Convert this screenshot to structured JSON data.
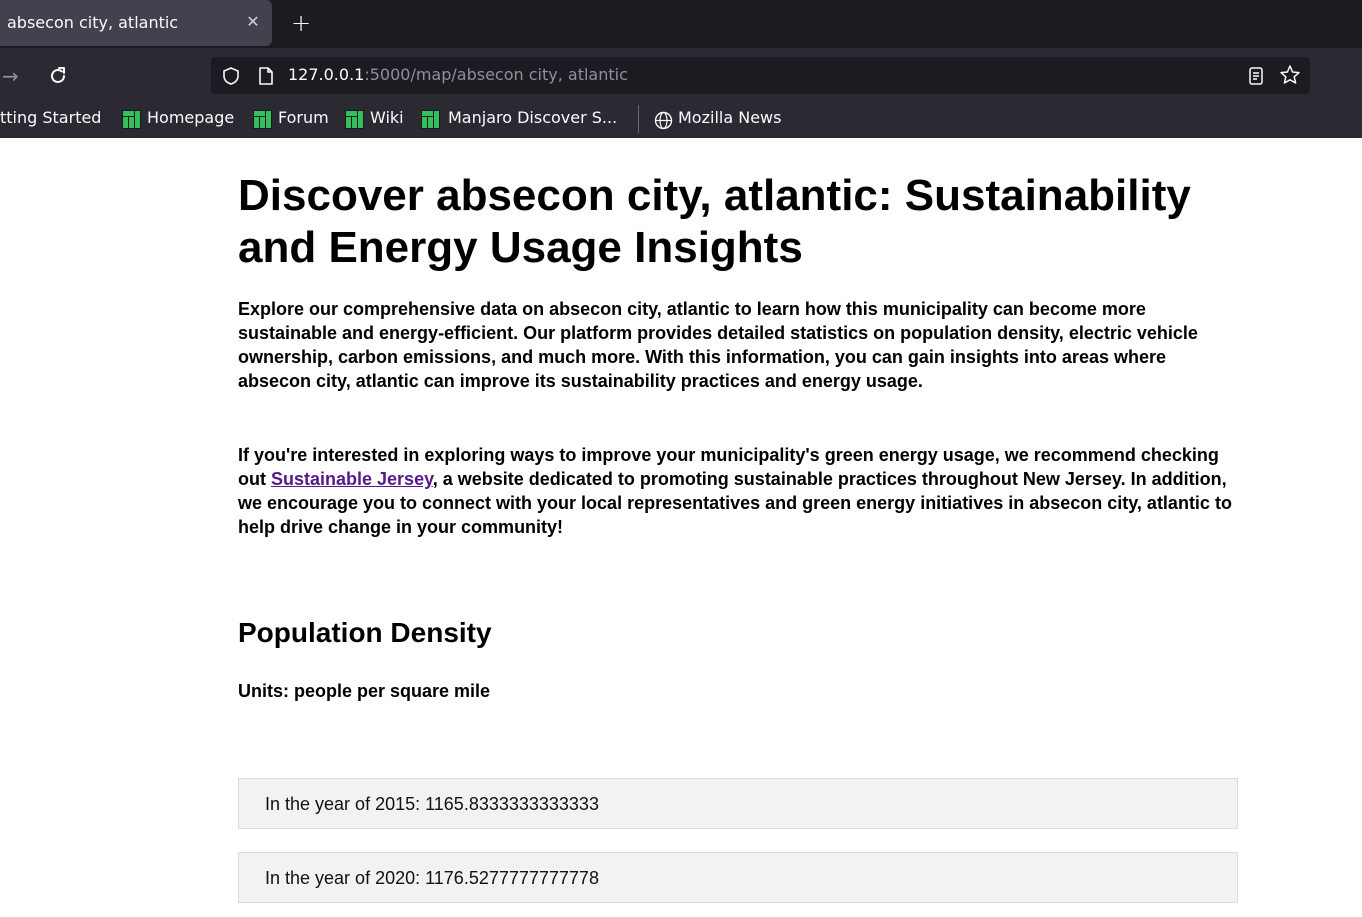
{
  "browser": {
    "tab_title": "absecon city, atlantic",
    "tab_close_icon": "close-icon",
    "new_tab_icon": "plus-icon",
    "url_host": "127.0.0.1",
    "url_rest": ":5000/map/absecon city, atlantic",
    "bookmarks": [
      {
        "label": "tting Started"
      },
      {
        "label": "Homepage"
      },
      {
        "label": "Forum"
      },
      {
        "label": "Wiki"
      },
      {
        "label": "Manjaro Discover S..."
      },
      {
        "label": "Mozilla News"
      }
    ],
    "colors": {
      "bookmark_icon": "#35bf5c",
      "toolbar": "#2b2a33",
      "tabstrip": "#1c1b22"
    }
  },
  "page": {
    "title": "Discover absecon city, atlantic: Sustainability and Energy Usage Insights",
    "intro": "Explore our comprehensive data on absecon city, atlantic to learn how this municipality can become more sustainable and energy-efficient. Our platform provides detailed statistics on population density, electric vehicle ownership, carbon emissions, and much more. With this information, you can gain insights into areas where absecon city, atlantic can improve its sustainability practices and energy usage.",
    "para2_before": "If you're interested in exploring ways to improve your municipality's green energy usage, we recommend checking out ",
    "para2_link": "Sustainable Jersey",
    "para2_after": ", a website dedicated to promoting sustainable practices throughout New Jersey. In addition, we encourage you to connect with your local representatives and green energy initiatives in absecon city, atlantic to help drive change in your community!",
    "section_title": "Population Density",
    "units": "Units: people per square mile",
    "years": [
      {
        "text": "In the year of 2015: 1165.8333333333333"
      },
      {
        "text": "In the year of 2020: 1176.5277777777778"
      }
    ],
    "colors": {
      "link": "#551a8b",
      "yearbox_bg": "#f2f2f2"
    }
  }
}
